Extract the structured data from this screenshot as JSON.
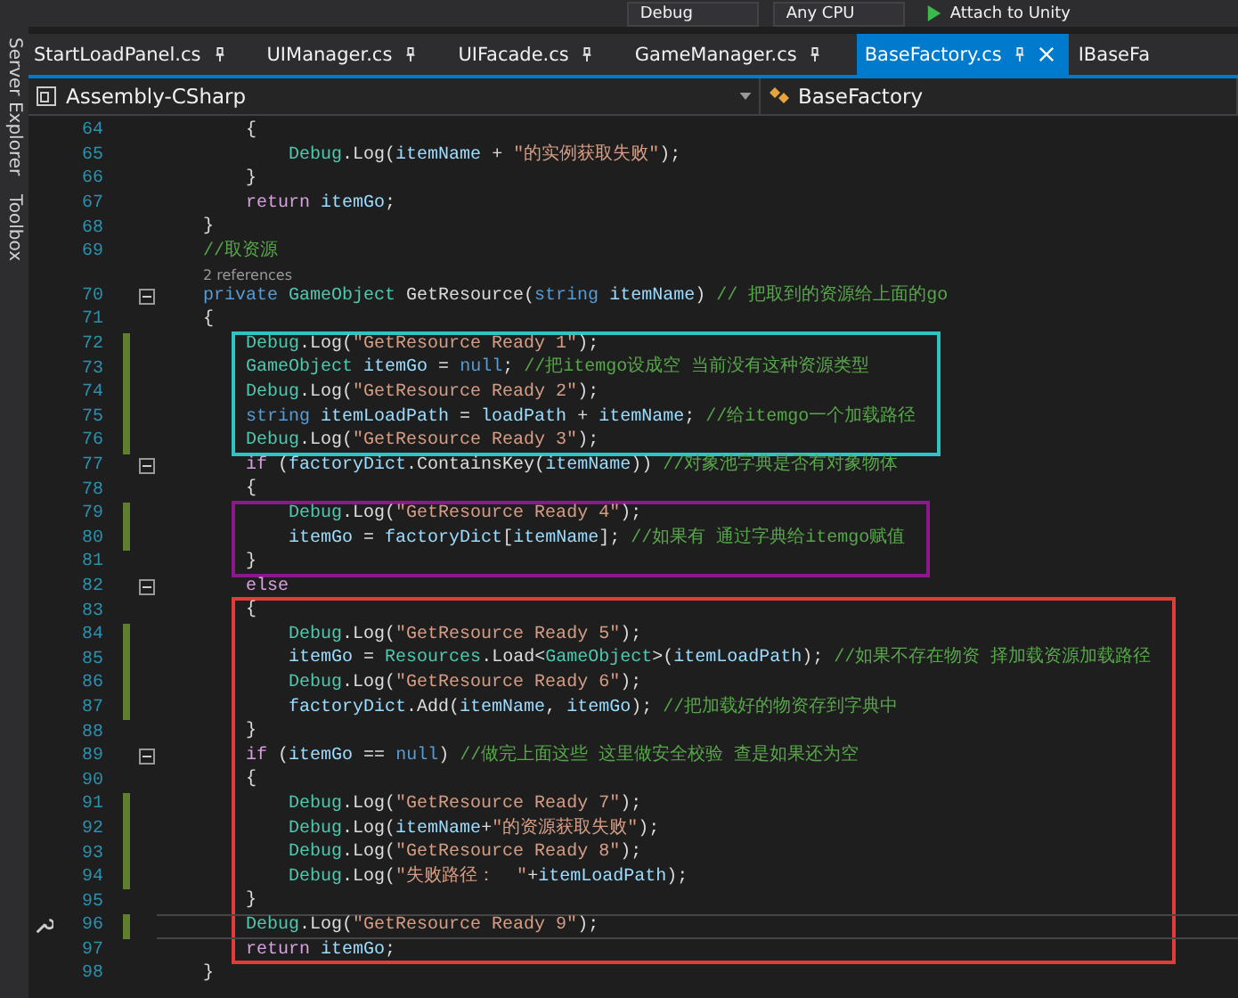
{
  "toolbar": {
    "items": [
      {
        "label": "Debug",
        "kind": "dropdown"
      },
      {
        "label": "Any CPU",
        "kind": "dropdown"
      },
      {
        "label": "Attach to Unity",
        "kind": "run"
      }
    ]
  },
  "side_panel": {
    "tabs": [
      "Server Explorer",
      "Toolbox"
    ]
  },
  "tabs": [
    {
      "label": "StartLoadPanel.cs",
      "selected": false
    },
    {
      "label": "UIManager.cs",
      "selected": false
    },
    {
      "label": "UIFacade.cs",
      "selected": false
    },
    {
      "label": "GameManager.cs",
      "selected": false
    },
    {
      "label": "BaseFactory.cs",
      "selected": true
    },
    {
      "label": "IBaseFa",
      "selected": false
    }
  ],
  "navigation_bar": {
    "project": "Assembly-CSharp",
    "class": "BaseFactory"
  },
  "editor": {
    "blocks": [
      {
        "lines": [
          {
            "kind": "code",
            "number": "64",
            "segments": [
              {
                "text": "        {",
                "kind": "plain"
              }
            ]
          },
          {
            "kind": "code",
            "number": "65",
            "segments": [
              {
                "text": "            Debug",
                "kind": "type"
              },
              {
                "text": ".Log(",
                "kind": "plain"
              },
              {
                "text": "itemName",
                "kind": "variable"
              },
              {
                "text": " + ",
                "kind": "plain"
              },
              {
                "text": "\"的实例获取失败\"",
                "kind": "string"
              },
              {
                "text": ");",
                "kind": "plain"
              }
            ]
          },
          {
            "kind": "code",
            "number": "66",
            "segments": [
              {
                "text": "        }",
                "kind": "plain"
              }
            ]
          },
          {
            "kind": "code",
            "number": "67",
            "segments": [
              {
                "text": "        return ",
                "kind": "control"
              },
              {
                "text": "itemGo",
                "kind": "variable"
              },
              {
                "text": ";",
                "kind": "plain"
              }
            ]
          },
          {
            "kind": "code",
            "number": "68",
            "segments": [
              {
                "text": "    }",
                "kind": "plain"
              }
            ]
          },
          {
            "kind": "code",
            "number": "69",
            "segments": [
              {
                "text": "    //取资源",
                "kind": "comment"
              }
            ]
          },
          {
            "kind": "codelens",
            "text": "2 references"
          },
          {
            "kind": "code",
            "number": "70",
            "fold": true,
            "segments": [
              {
                "text": "    private ",
                "kind": "keyword"
              },
              {
                "text": "GameObject",
                "kind": "type"
              },
              {
                "text": " GetResource(",
                "kind": "plain"
              },
              {
                "text": "string ",
                "kind": "keyword"
              },
              {
                "text": "itemName",
                "kind": "variable"
              },
              {
                "text": ") ",
                "kind": "plain"
              },
              {
                "text": "// 把取到的资源给上面的go",
                "kind": "comment"
              }
            ]
          },
          {
            "kind": "code",
            "number": "71",
            "segments": [
              {
                "text": "    {",
                "kind": "plain"
              }
            ]
          }
        ]
      },
      {
        "color": "#2ec4c4",
        "lines": [
          {
            "kind": "code",
            "number": "72",
            "changed": true,
            "segments": [
              {
                "text": "        Debug",
                "kind": "type"
              },
              {
                "text": ".Log(",
                "kind": "plain"
              },
              {
                "text": "\"GetResource Ready 1\"",
                "kind": "string"
              },
              {
                "text": ");",
                "kind": "plain"
              }
            ]
          },
          {
            "kind": "code",
            "number": "73",
            "changed": true,
            "segments": [
              {
                "text": "        GameObject ",
                "kind": "type"
              },
              {
                "text": "itemGo",
                "kind": "variable"
              },
              {
                "text": " = ",
                "kind": "plain"
              },
              {
                "text": "null",
                "kind": "keyword"
              },
              {
                "text": "; ",
                "kind": "plain"
              },
              {
                "text": "//把itemgo设成空 当前没有这种资源类型",
                "kind": "comment"
              }
            ]
          },
          {
            "kind": "code",
            "number": "74",
            "changed": true,
            "segments": [
              {
                "text": "        Debug",
                "kind": "type"
              },
              {
                "text": ".Log(",
                "kind": "plain"
              },
              {
                "text": "\"GetResource Ready 2\"",
                "kind": "string"
              },
              {
                "text": ");",
                "kind": "plain"
              }
            ]
          },
          {
            "kind": "code",
            "number": "75",
            "changed": true,
            "segments": [
              {
                "text": "        string ",
                "kind": "keyword"
              },
              {
                "text": "itemLoadPath",
                "kind": "variable"
              },
              {
                "text": " = ",
                "kind": "plain"
              },
              {
                "text": "loadPath",
                "kind": "variable"
              },
              {
                "text": " + ",
                "kind": "plain"
              },
              {
                "text": "itemName",
                "kind": "variable"
              },
              {
                "text": "; ",
                "kind": "plain"
              },
              {
                "text": "//给itemgo一个加载路径",
                "kind": "comment"
              }
            ]
          },
          {
            "kind": "code",
            "number": "76",
            "changed": true,
            "segments": [
              {
                "text": "        Debug",
                "kind": "type"
              },
              {
                "text": ".Log(",
                "kind": "plain"
              },
              {
                "text": "\"GetResource Ready 3\"",
                "kind": "string"
              },
              {
                "text": ");",
                "kind": "plain"
              }
            ]
          }
        ]
      },
      {
        "lines": [
          {
            "kind": "code",
            "number": "77",
            "fold": true,
            "segments": [
              {
                "text": "        if",
                "kind": "control"
              },
              {
                "text": " (",
                "kind": "plain"
              },
              {
                "text": "factoryDict",
                "kind": "variable"
              },
              {
                "text": ".ContainsKey(",
                "kind": "plain"
              },
              {
                "text": "itemName",
                "kind": "variable"
              },
              {
                "text": ")) ",
                "kind": "plain"
              },
              {
                "text": "//对象池字典是否有对象物体",
                "kind": "comment"
              }
            ]
          },
          {
            "kind": "code",
            "number": "78",
            "segments": [
              {
                "text": "        {",
                "kind": "plain"
              }
            ]
          }
        ]
      },
      {
        "color": "#8a1a8a",
        "lines": [
          {
            "kind": "code",
            "number": "79",
            "changed": true,
            "segments": [
              {
                "text": "            Debug",
                "kind": "type"
              },
              {
                "text": ".Log(",
                "kind": "plain"
              },
              {
                "text": "\"GetResource Ready 4\"",
                "kind": "string"
              },
              {
                "text": ");",
                "kind": "plain"
              }
            ]
          },
          {
            "kind": "code",
            "number": "80",
            "changed": true,
            "segments": [
              {
                "text": "            itemGo",
                "kind": "variable"
              },
              {
                "text": " = ",
                "kind": "plain"
              },
              {
                "text": "factoryDict",
                "kind": "variable"
              },
              {
                "text": "[",
                "kind": "plain"
              },
              {
                "text": "itemName",
                "kind": "variable"
              },
              {
                "text": "]; ",
                "kind": "plain"
              },
              {
                "text": "//如果有 通过字典给itemgo赋值",
                "kind": "comment"
              }
            ]
          },
          {
            "kind": "code",
            "number": "81",
            "segments": [
              {
                "text": "        }",
                "kind": "plain"
              }
            ]
          }
        ]
      },
      {
        "lines": [
          {
            "kind": "code",
            "number": "82",
            "fold": true,
            "segments": [
              {
                "text": "        else",
                "kind": "control"
              }
            ]
          }
        ]
      },
      {
        "color": "#e03c3c",
        "lines": [
          {
            "kind": "code",
            "number": "83",
            "segments": [
              {
                "text": "        {",
                "kind": "plain"
              }
            ]
          },
          {
            "kind": "code",
            "number": "84",
            "changed": true,
            "segments": [
              {
                "text": "            Debug",
                "kind": "type"
              },
              {
                "text": ".Log(",
                "kind": "plain"
              },
              {
                "text": "\"GetResource Ready 5\"",
                "kind": "string"
              },
              {
                "text": ");",
                "kind": "plain"
              }
            ]
          },
          {
            "kind": "code",
            "number": "85",
            "changed": true,
            "segments": [
              {
                "text": "            itemGo",
                "kind": "variable"
              },
              {
                "text": " = ",
                "kind": "plain"
              },
              {
                "text": "Resources",
                "kind": "type"
              },
              {
                "text": ".Load<",
                "kind": "plain"
              },
              {
                "text": "GameObject",
                "kind": "type"
              },
              {
                "text": ">(",
                "kind": "plain"
              },
              {
                "text": "itemLoadPath",
                "kind": "variable"
              },
              {
                "text": "); ",
                "kind": "plain"
              },
              {
                "text": "//如果不存在物资 择加载资源加载路径",
                "kind": "comment"
              }
            ]
          },
          {
            "kind": "code",
            "number": "86",
            "changed": true,
            "segments": [
              {
                "text": "            Debug",
                "kind": "type"
              },
              {
                "text": ".Log(",
                "kind": "plain"
              },
              {
                "text": "\"GetResource Ready 6\"",
                "kind": "string"
              },
              {
                "text": ");",
                "kind": "plain"
              }
            ]
          },
          {
            "kind": "code",
            "number": "87",
            "changed": true,
            "segments": [
              {
                "text": "            factoryDict",
                "kind": "variable"
              },
              {
                "text": ".Add(",
                "kind": "plain"
              },
              {
                "text": "itemName",
                "kind": "variable"
              },
              {
                "text": ", ",
                "kind": "plain"
              },
              {
                "text": "itemGo",
                "kind": "variable"
              },
              {
                "text": "); ",
                "kind": "plain"
              },
              {
                "text": "//把加载好的物资存到字典中",
                "kind": "comment"
              }
            ]
          },
          {
            "kind": "code",
            "number": "88",
            "segments": [
              {
                "text": "        }",
                "kind": "plain"
              }
            ]
          },
          {
            "kind": "code",
            "number": "89",
            "fold": true,
            "segments": [
              {
                "text": "        if",
                "kind": "control"
              },
              {
                "text": " (",
                "kind": "plain"
              },
              {
                "text": "itemGo",
                "kind": "variable"
              },
              {
                "text": " == ",
                "kind": "plain"
              },
              {
                "text": "null",
                "kind": "keyword"
              },
              {
                "text": ") ",
                "kind": "plain"
              },
              {
                "text": "//做完上面这些 这里做安全校验 查是如果还为空",
                "kind": "comment"
              }
            ]
          },
          {
            "kind": "code",
            "number": "90",
            "segments": [
              {
                "text": "        {",
                "kind": "plain"
              }
            ]
          },
          {
            "kind": "code",
            "number": "91",
            "changed": true,
            "segments": [
              {
                "text": "            Debug",
                "kind": "type"
              },
              {
                "text": ".Log(",
                "kind": "plain"
              },
              {
                "text": "\"GetResource Ready 7\"",
                "kind": "string"
              },
              {
                "text": ");",
                "kind": "plain"
              }
            ]
          },
          {
            "kind": "code",
            "number": "92",
            "changed": true,
            "segments": [
              {
                "text": "            Debug",
                "kind": "type"
              },
              {
                "text": ".Log(",
                "kind": "plain"
              },
              {
                "text": "itemName",
                "kind": "variable"
              },
              {
                "text": "+",
                "kind": "plain"
              },
              {
                "text": "\"的资源获取失败\"",
                "kind": "string"
              },
              {
                "text": ");",
                "kind": "plain"
              }
            ]
          },
          {
            "kind": "code",
            "number": "93",
            "changed": true,
            "segments": [
              {
                "text": "            Debug",
                "kind": "type"
              },
              {
                "text": ".Log(",
                "kind": "plain"
              },
              {
                "text": "\"GetResource Ready 8\"",
                "kind": "string"
              },
              {
                "text": ");",
                "kind": "plain"
              }
            ]
          },
          {
            "kind": "code",
            "number": "94",
            "changed": true,
            "segments": [
              {
                "text": "            Debug",
                "kind": "type"
              },
              {
                "text": ".Log(",
                "kind": "plain"
              },
              {
                "text": "\"失败路径：  \"",
                "kind": "string"
              },
              {
                "text": "+",
                "kind": "plain"
              },
              {
                "text": "itemLoadPath",
                "kind": "variable"
              },
              {
                "text": ");",
                "kind": "plain"
              }
            ]
          },
          {
            "kind": "code",
            "number": "95",
            "segments": [
              {
                "text": "        }",
                "kind": "plain"
              }
            ]
          },
          {
            "kind": "code",
            "number": "96",
            "changed": true,
            "current": true,
            "segments": [
              {
                "text": "        Debug",
                "kind": "type"
              },
              {
                "text": ".Log(",
                "kind": "plain"
              },
              {
                "text": "\"GetResource Ready 9\"",
                "kind": "string"
              },
              {
                "text": ");",
                "kind": "plain"
              }
            ]
          },
          {
            "kind": "code",
            "number": "97",
            "segments": [
              {
                "text": "        return ",
                "kind": "control"
              },
              {
                "text": "itemGo",
                "kind": "variable"
              },
              {
                "text": ";",
                "kind": "plain"
              }
            ]
          }
        ]
      },
      {
        "lines": [
          {
            "kind": "code",
            "number": "98",
            "segments": [
              {
                "text": "    }",
                "kind": "plain"
              }
            ]
          }
        ]
      }
    ]
  }
}
